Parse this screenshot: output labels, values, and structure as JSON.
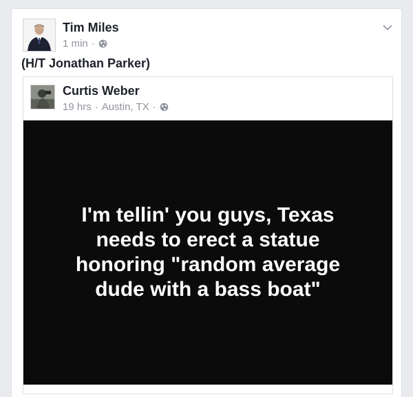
{
  "post": {
    "author": "Tim Miles",
    "time": "1 min",
    "separator": "·",
    "privacy_icon": "globe-icon",
    "menu_icon": "chevron-down-icon",
    "text": "(H/T Jonathan Parker)"
  },
  "shared_post": {
    "author": "Curtis Weber",
    "time": "19 hrs",
    "separator": "·",
    "location": "Austin, TX",
    "separator2": "·",
    "privacy_icon": "globe-icon",
    "quote": "I'm tellin' you guys, Texas\nneeds to erect a statue\nhonoring  \"random average\ndude with a bass boat\""
  },
  "colors": {
    "background": "#e9ebee",
    "card": "#ffffff",
    "name": "#1d2129",
    "meta": "#90949c",
    "quote_bg": "#0b0b0b",
    "quote_text": "#ffffff"
  }
}
